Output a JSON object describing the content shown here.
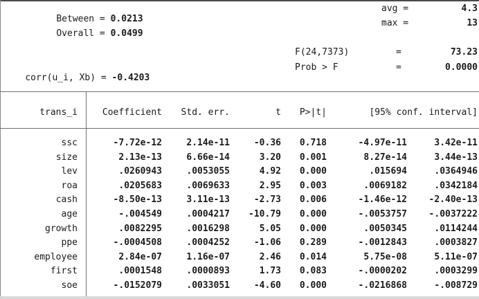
{
  "stats": {
    "between_label": "Between = ",
    "between_value": "0.0213",
    "overall_label": "Overall = ",
    "overall_value": "0.0499",
    "avg_label": "avg =",
    "avg_value": "4.3",
    "max_label": "max =",
    "max_value": "13",
    "f_label": "F(24,7373)",
    "f_eq": "=",
    "f_value": "73.23",
    "prob_label": "Prob > F",
    "prob_eq": "=",
    "prob_value": "0.0000",
    "corr_label": "corr(u_i, Xb) = ",
    "corr_value": "-0.4203"
  },
  "table": {
    "depvar": "trans_i",
    "headers": [
      "Coefficient",
      "Std. err.",
      "t",
      "P>|t|",
      "[95% conf. interval]"
    ],
    "rows": [
      {
        "name": "ssc",
        "coef": "-7.72e-12",
        "se": "2.14e-11",
        "t": "-0.36",
        "p": "0.718",
        "lo": "-4.97e-11",
        "hi": "3.42e-11"
      },
      {
        "name": "size",
        "coef": "2.13e-13",
        "se": "6.66e-14",
        "t": "3.20",
        "p": "0.001",
        "lo": "8.27e-14",
        "hi": "3.44e-13"
      },
      {
        "name": "lev",
        "coef": ".0260943",
        "se": ".0053055",
        "t": "4.92",
        "p": "0.000",
        "lo": ".015694",
        "hi": ".0364946"
      },
      {
        "name": "roa",
        "coef": ".0205683",
        "se": ".0069633",
        "t": "2.95",
        "p": "0.003",
        "lo": ".0069182",
        "hi": ".0342184"
      },
      {
        "name": "cash",
        "coef": "-8.50e-13",
        "se": "3.11e-13",
        "t": "-2.73",
        "p": "0.006",
        "lo": "-1.46e-12",
        "hi": "-2.40e-13"
      },
      {
        "name": "age",
        "coef": "-.004549",
        "se": ".0004217",
        "t": "-10.79",
        "p": "0.000",
        "lo": "-.0053757",
        "hi": "-.0037222"
      },
      {
        "name": "growth",
        "coef": ".0082295",
        "se": ".0016298",
        "t": "5.05",
        "p": "0.000",
        "lo": ".0050345",
        "hi": ".0114244"
      },
      {
        "name": "ppe",
        "coef": "-.0004508",
        "se": ".0004252",
        "t": "-1.06",
        "p": "0.289",
        "lo": "-.0012843",
        "hi": ".0003827"
      },
      {
        "name": "employee",
        "coef": "2.84e-07",
        "se": "1.16e-07",
        "t": "2.46",
        "p": "0.014",
        "lo": "5.75e-08",
        "hi": "5.11e-07"
      },
      {
        "name": "first",
        "coef": ".0001548",
        "se": ".0000893",
        "t": "1.73",
        "p": "0.083",
        "lo": "-.0000202",
        "hi": ".0003299"
      },
      {
        "name": "soe",
        "coef": "-.0152079",
        "se": ".0033051",
        "t": "-4.60",
        "p": "0.000",
        "lo": "-.0216868",
        "hi": "-.008729"
      }
    ]
  }
}
